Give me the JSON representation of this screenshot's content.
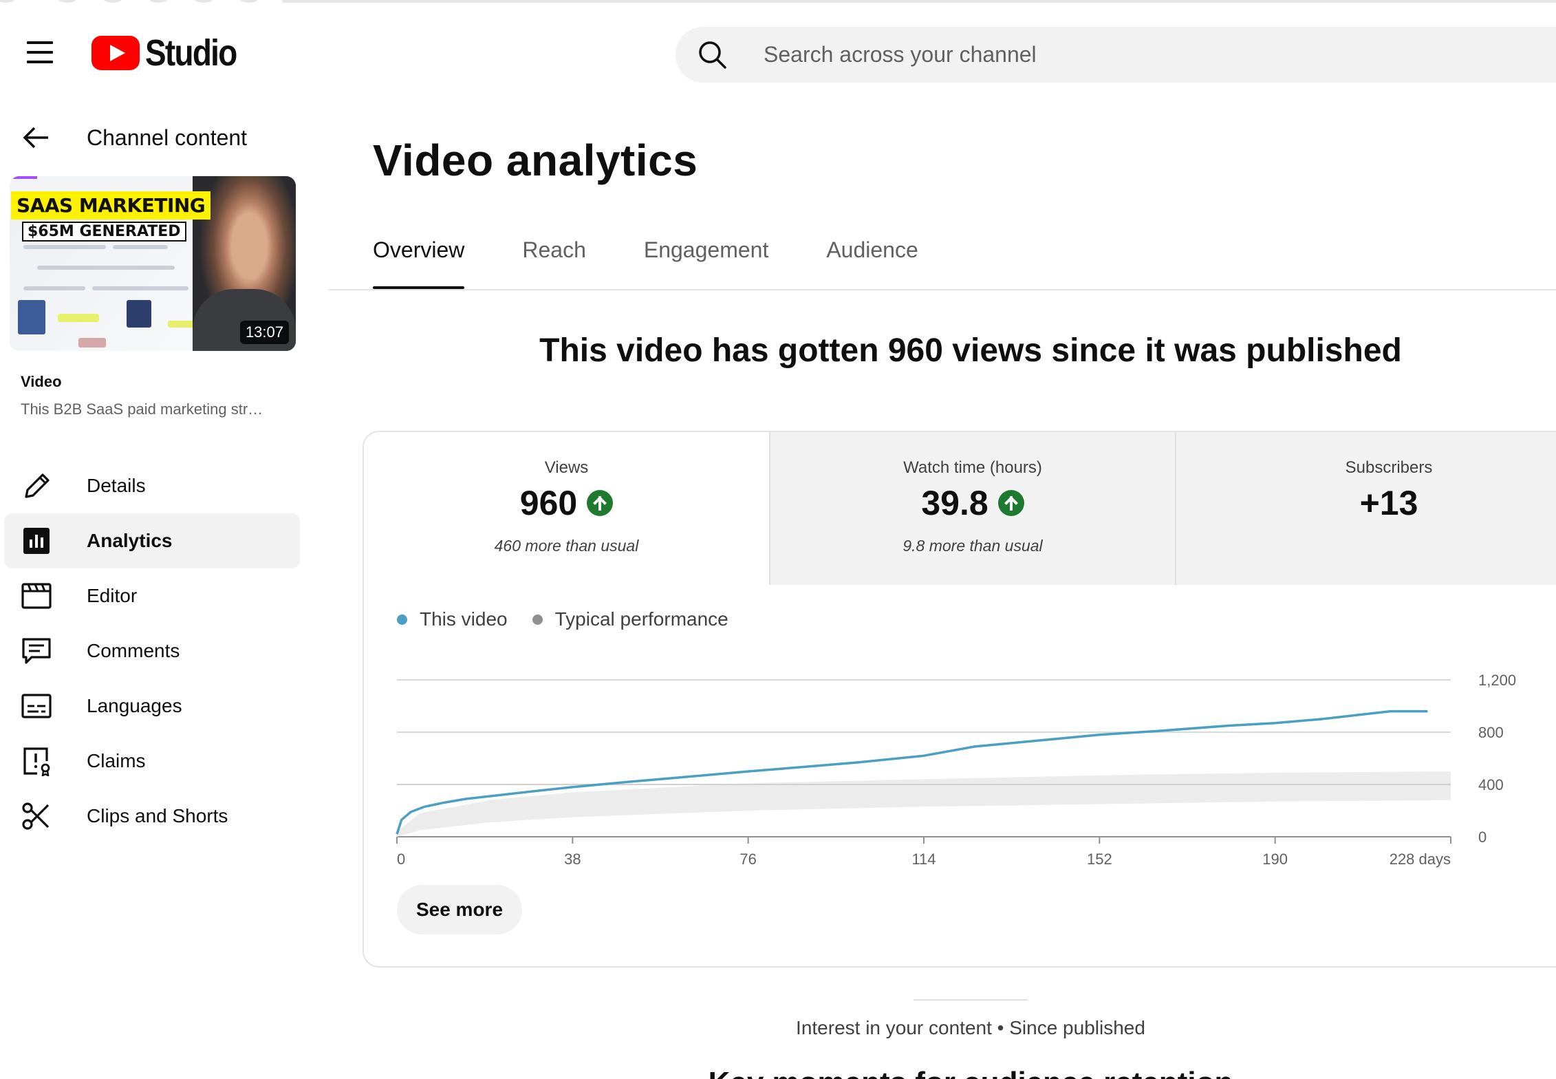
{
  "header": {
    "logo_text": "Studio",
    "search_placeholder": "Search across your channel"
  },
  "sidebar": {
    "back_label": "Channel content",
    "thumbnail": {
      "headline_1": "SAAS MARKETING",
      "headline_2": "$65M GENERATED",
      "duration": "13:07"
    },
    "video_label": "Video",
    "video_title": "This B2B SaaS paid marketing str…",
    "items": [
      {
        "label": "Details",
        "icon": "pencil-icon",
        "active": false
      },
      {
        "label": "Analytics",
        "icon": "analytics-icon",
        "active": true
      },
      {
        "label": "Editor",
        "icon": "clapperboard-icon",
        "active": false
      },
      {
        "label": "Comments",
        "icon": "comment-icon",
        "active": false
      },
      {
        "label": "Languages",
        "icon": "subtitles-icon",
        "active": false
      },
      {
        "label": "Claims",
        "icon": "claims-icon",
        "active": false
      },
      {
        "label": "Clips and Shorts",
        "icon": "scissors-icon",
        "active": false
      }
    ]
  },
  "main": {
    "title": "Video analytics",
    "tabs": [
      {
        "label": "Overview",
        "active": true
      },
      {
        "label": "Reach",
        "active": false
      },
      {
        "label": "Engagement",
        "active": false
      },
      {
        "label": "Audience",
        "active": false
      }
    ],
    "headline": "This video has gotten 960 views since it was published",
    "metrics": [
      {
        "label": "Views",
        "value": "960",
        "trend": "up",
        "sub": "460 more than usual"
      },
      {
        "label": "Watch time (hours)",
        "value": "39.8",
        "trend": "up",
        "sub": "9.8 more than usual"
      },
      {
        "label": "Subscribers",
        "value": "+13",
        "trend": "none",
        "sub": ""
      }
    ],
    "see_more_label": "See more",
    "interest_label": "Interest in your content • Since published",
    "next_heading": "Key moments for audience retention"
  },
  "colors": {
    "this_video": "#4b9ec4",
    "typical": "#909090",
    "typical_band": "#ececec",
    "trend_up": "#1e7a2e"
  },
  "chart_data": {
    "type": "line",
    "legend": [
      {
        "name": "This video",
        "color": "#4b9ec4"
      },
      {
        "name": "Typical performance",
        "color": "#909090"
      }
    ],
    "legend_position": "top-left",
    "x_ticks": [
      "0",
      "38",
      "76",
      "114",
      "152",
      "190",
      "228 days"
    ],
    "y_ticks": [
      "0",
      "400",
      "800",
      "1,200"
    ],
    "xlim": [
      0,
      228
    ],
    "ylim": [
      0,
      1200
    ],
    "y_axis_side": "right",
    "grid": true,
    "series": [
      {
        "name": "This video",
        "x": [
          0,
          1,
          3,
          6,
          10,
          15,
          20,
          30,
          38,
          50,
          60,
          76,
          90,
          100,
          114,
          125,
          140,
          152,
          165,
          180,
          190,
          200,
          210,
          215,
          223
        ],
        "y": [
          20,
          130,
          190,
          230,
          260,
          290,
          310,
          350,
          380,
          420,
          450,
          500,
          540,
          570,
          620,
          690,
          740,
          780,
          810,
          850,
          870,
          900,
          940,
          960,
          960
        ]
      },
      {
        "name": "Typical performance",
        "x": [
          0,
          5,
          20,
          38,
          76,
          114,
          152,
          190,
          228
        ],
        "y_low": [
          0,
          50,
          110,
          150,
          200,
          230,
          250,
          270,
          280
        ],
        "y_high": [
          40,
          180,
          280,
          340,
          410,
          440,
          470,
          490,
          500
        ]
      }
    ]
  }
}
